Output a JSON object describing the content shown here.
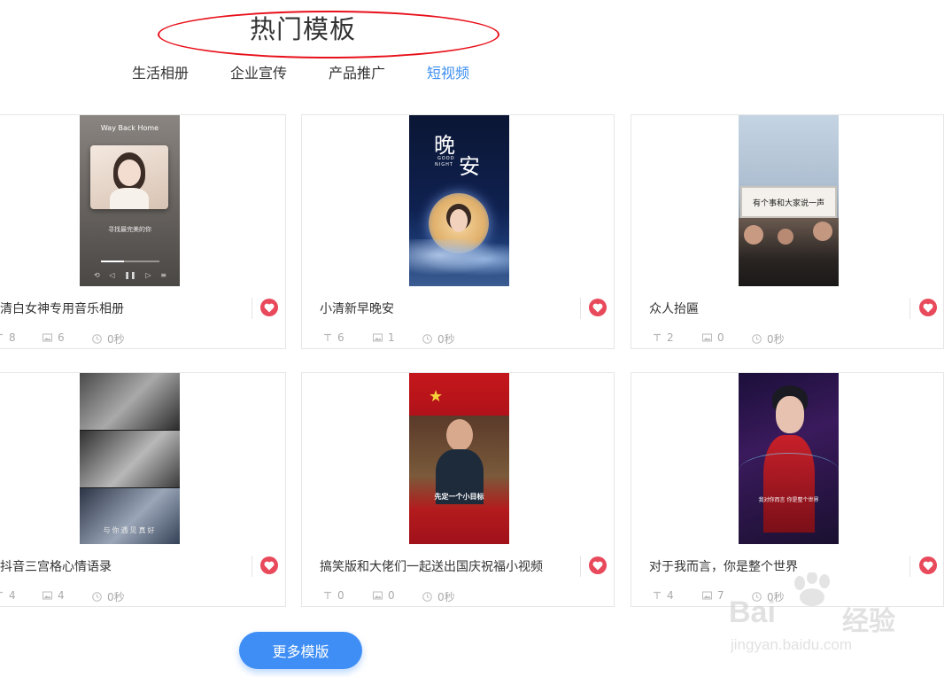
{
  "section": {
    "title": "热门模板"
  },
  "tabs": [
    {
      "label": "生活相册"
    },
    {
      "label": "企业宣传"
    },
    {
      "label": "产品推广"
    },
    {
      "label": "短视频"
    }
  ],
  "active_tab": "短视频",
  "cards": [
    {
      "title": "清白女神专用音乐相册",
      "text_count": "8",
      "image_count": "6",
      "duration": "0秒",
      "thumb": {
        "app_title": "Way Back Home",
        "song_name": "寻找最完美的你"
      }
    },
    {
      "title": "小清新早晚安",
      "text_count": "6",
      "image_count": "1",
      "duration": "0秒",
      "thumb": {
        "main_char_1": "晚",
        "main_char_2": "安",
        "eng_1": "GOOD",
        "eng_2": "NIGHT"
      }
    },
    {
      "title": "众人抬匾",
      "text_count": "2",
      "image_count": "0",
      "duration": "0秒",
      "thumb": {
        "banner": "有个事和大家说一声"
      }
    },
    {
      "title": "抖音三宫格心情语录",
      "text_count": "4",
      "image_count": "4",
      "duration": "0秒",
      "thumb": {
        "caption": "与你遇见真好"
      }
    },
    {
      "title": "搞笑版和大佬们一起送出国庆祝福小视频",
      "text_count": "0",
      "image_count": "0",
      "duration": "0秒",
      "thumb": {
        "subtitle": "先定一个小目标"
      }
    },
    {
      "title": "对于我而言，你是整个世界",
      "text_count": "4",
      "image_count": "7",
      "duration": "0秒",
      "thumb": {
        "caption": "我对你而言 你是整个世界"
      }
    }
  ],
  "more_button": {
    "label": "更多模版"
  },
  "watermark": {
    "brand_left": "Bai",
    "brand_right": "经验",
    "url": "jingyan.baidu.com"
  },
  "colors": {
    "accent": "#3f8ef5",
    "active_tab": "#3d8ef0",
    "heart": "#e8495b",
    "annotation": "#e8101a"
  }
}
